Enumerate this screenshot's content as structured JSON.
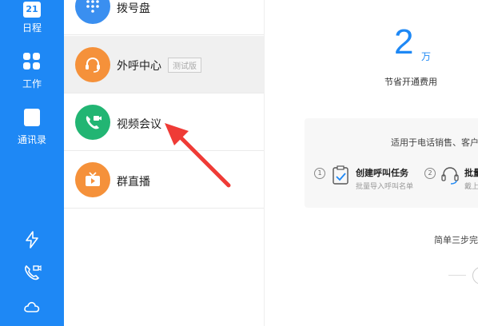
{
  "sidebar": {
    "items": [
      {
        "label": "日程",
        "badge": "21"
      },
      {
        "label": "工作"
      },
      {
        "label": "通讯录"
      }
    ]
  },
  "list": {
    "items": [
      {
        "label": "拨号盘",
        "color": "#3a8ff0"
      },
      {
        "label": "外呼中心",
        "badge": "测试版",
        "color": "#f5913a"
      },
      {
        "label": "视频会议",
        "color": "#22b573"
      },
      {
        "label": "群直播",
        "color": "#f5913a"
      }
    ]
  },
  "main": {
    "big_number": "2",
    "unit": "万",
    "subtitle": "节省开通费用",
    "card_title": "适用于电话销售、客户",
    "steps": [
      {
        "num": "1",
        "title": "创建呼叫任务",
        "sub": "批量导入呼叫名单"
      },
      {
        "num": "2",
        "title": "批量",
        "sub": "戴上"
      }
    ],
    "footer": "简单三步完"
  },
  "colors": {
    "accent": "#1e88f5",
    "annotation_arrow": "#ef3b36"
  }
}
